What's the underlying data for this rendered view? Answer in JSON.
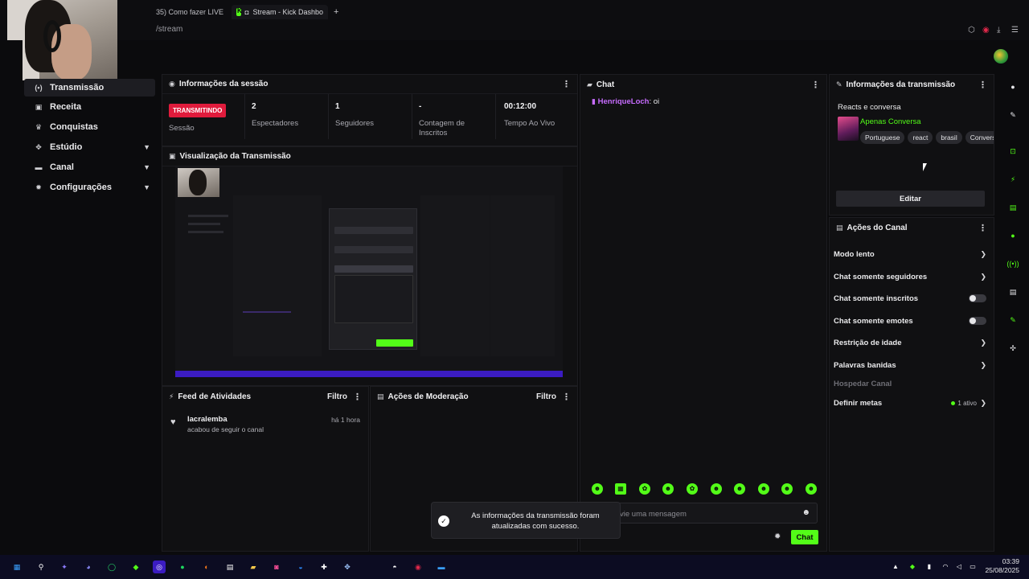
{
  "browser": {
    "tab_prev_label": "35) Como fazer LIVE n",
    "tab_active_label": "Stream - Kick Dashbo",
    "new_tab": "+",
    "url": "/stream"
  },
  "sidebar": {
    "items": [
      {
        "label": "Transmissão",
        "icon": "broadcast-icon"
      },
      {
        "label": "Receita",
        "icon": "wallet-icon"
      },
      {
        "label": "Conquistas",
        "icon": "trophy-icon"
      },
      {
        "label": "Estúdio",
        "icon": "studio-icon"
      },
      {
        "label": "Canal",
        "icon": "channel-icon"
      },
      {
        "label": "Configurações",
        "icon": "gear-icon"
      }
    ]
  },
  "session": {
    "title": "Informações da sessão",
    "live_badge": "TRANSMITINDO",
    "live_label": "Sessão",
    "viewers_value": "2",
    "viewers_label": "Espectadores",
    "followers_value": "1",
    "followers_label": "Seguidores",
    "subs_value": "-",
    "subs_label": "Contagem de Inscritos",
    "time_value": "00:12:00",
    "time_label": "Tempo Ao Vivo"
  },
  "preview": {
    "title": "Visualização da Transmissão"
  },
  "feed": {
    "title": "Feed de Atividades",
    "filter": "Filtro",
    "items": [
      {
        "user": "lacralemba",
        "action": "acabou de seguir o canal",
        "time": "há 1 hora"
      }
    ]
  },
  "moderation": {
    "title": "Ações de Moderação",
    "filter": "Filtro"
  },
  "chat": {
    "title": "Chat",
    "messages": [
      {
        "user": "HenriqueLoch",
        "sep": ":",
        "text": "oi"
      }
    ],
    "placeholder": "vie uma mensagem",
    "send": "Chat"
  },
  "toast": {
    "message": "As informações da transmissão foram atualizadas com sucesso."
  },
  "stream_info": {
    "title": "Informações da transmissão",
    "stream_title": "Reacts e conversa",
    "category": "Apenas Conversa",
    "tags": [
      "Portuguese",
      "react",
      "brasil",
      "Convers"
    ],
    "edit": "Editar"
  },
  "channel_actions": {
    "title": "Ações do Canal",
    "slow_mode": "Modo lento",
    "followers_only": "Chat somente seguidores",
    "subs_only": "Chat somente inscritos",
    "emotes_only": "Chat somente emotes",
    "age_restriction": "Restrição de idade",
    "banned_words": "Palavras banidas",
    "host_channel": "Hospedar Canal",
    "goals": "Definir metas",
    "goals_status": "1 ativo"
  },
  "taskbar": {
    "time": "03:39",
    "date": "25/08/2025"
  },
  "colors": {
    "accent": "#53fc18",
    "live": "#e01b3c",
    "chat_user": "#c76cff"
  }
}
